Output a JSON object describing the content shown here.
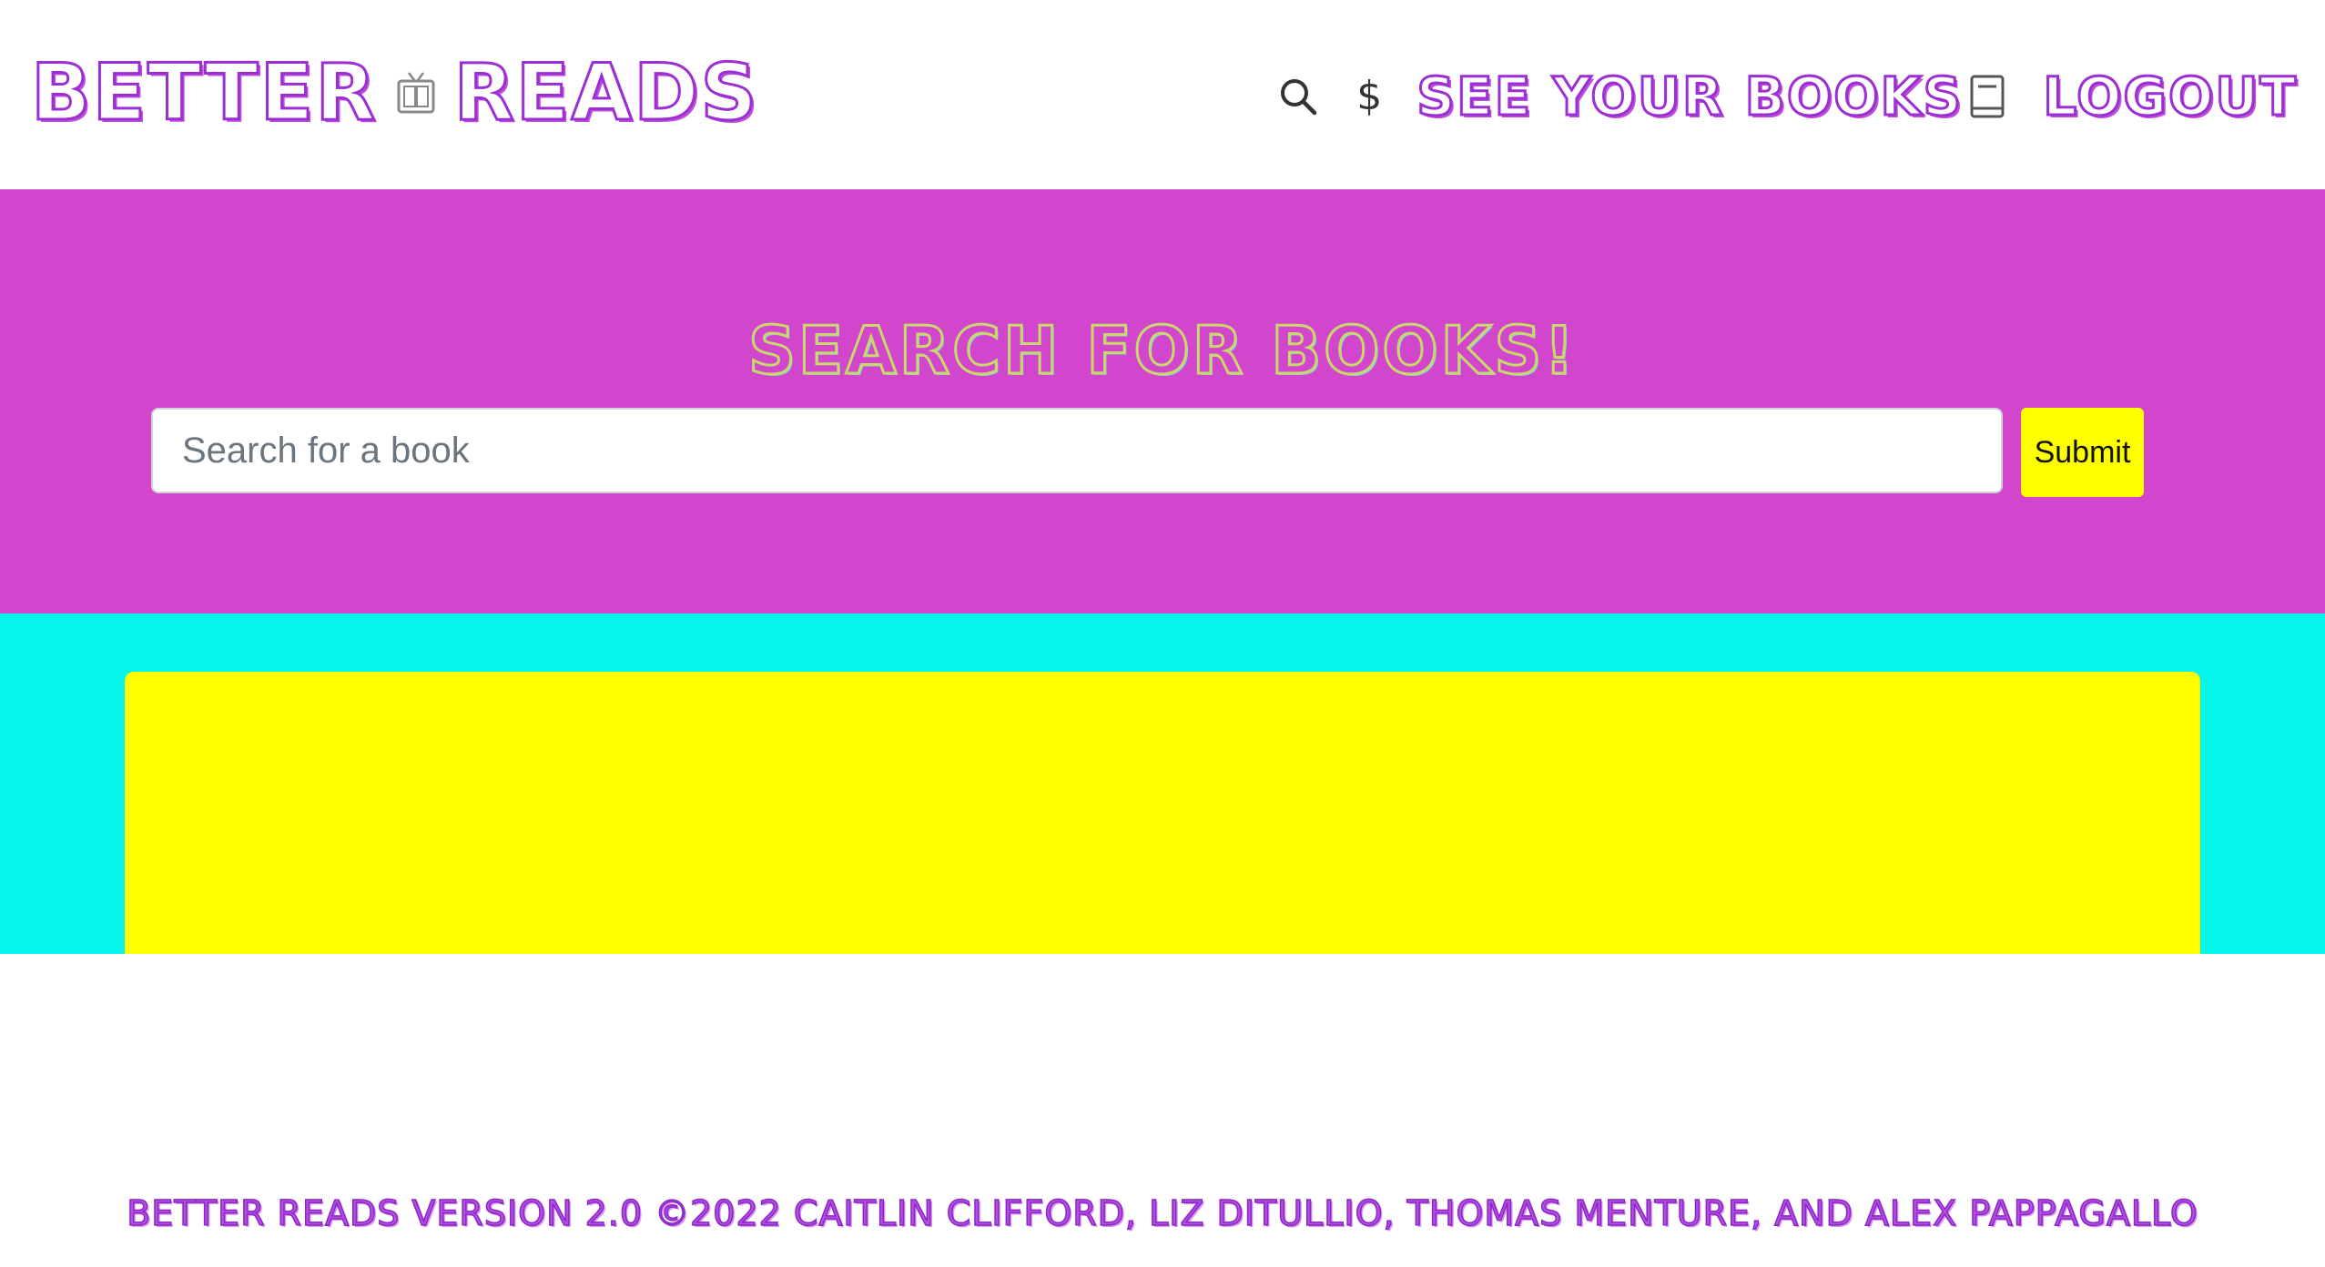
{
  "navbar": {
    "brand_left": "BETTER",
    "brand_right": "READS",
    "brand_icon": "tv-book-icon",
    "search_icon": "search-icon",
    "dollar_symbol": "$",
    "see_books_label": "SEE YOUR BOOKS",
    "book_icon": "book-icon",
    "logout_label": "LOGOUT"
  },
  "hero": {
    "title": "SEARCH FOR BOOKS!",
    "search_placeholder": "Search for a book",
    "search_value": "",
    "submit_label": "Submit"
  },
  "footer": {
    "text": "BETTER READS VERSION 2.0 ©2022 CAITLIN CLIFFORD, LIZ DITULLIO, THOMAS MENTURE, AND ALEX PAPPAGALLO"
  },
  "colors": {
    "hero_background": "#d246cd",
    "results_background": "#05f5ea",
    "results_card": "#ffff00",
    "submit_button": "#ffff00",
    "accent_purple": "#9b2ed4"
  }
}
